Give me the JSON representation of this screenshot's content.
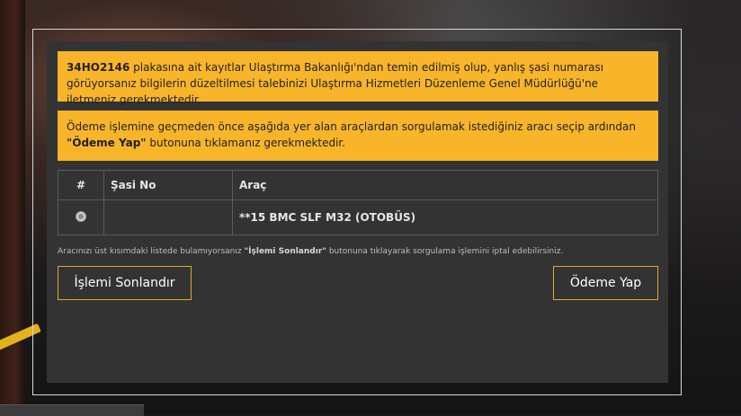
{
  "notices": [
    {
      "plate": "34HO2146",
      "text": " plakasına ait kayıtlar Ulaştırma Bakanlığı'ndan temin edilmiş olup, yanlış şasi numarası görüyorsanız bilgilerin düzeltilmesi talebinizi Ulaştırma Hizmetleri Düzenleme Genel Müdürlüğü'ne iletmeniz gerekmektedir."
    },
    {
      "text_before": "Ödeme işlemine geçmeden önce aşağıda yer alan araçlardan sorgulamak istediğiniz aracı seçip ardından ",
      "button_ref": "\"Ödeme Yap\"",
      "text_after": " butonuna tıklamanız gerekmektedir."
    }
  ],
  "table": {
    "headers": [
      "#",
      "Şasi No",
      "Araç"
    ],
    "rows": [
      {
        "selected": false,
        "sasi_no": "",
        "arac": "**15 BMC SLF M32 (OTOBÜS)"
      }
    ]
  },
  "hint": {
    "before": "Aracınızı üst kısımdaki listede bulamıyorsanız ",
    "button_ref": "\"İşlemi Sonlandır\"",
    "after": " butonuna tıklayarak sorgulama işlemini iptal edebilirsiniz."
  },
  "buttons": {
    "cancel_label": "İşlemi Sonlandır",
    "pay_label": "Ödeme Yap"
  },
  "colors": {
    "notice_bg": "#f8b52a",
    "panel_bg": "#333333",
    "button_border": "#e0a92a"
  }
}
